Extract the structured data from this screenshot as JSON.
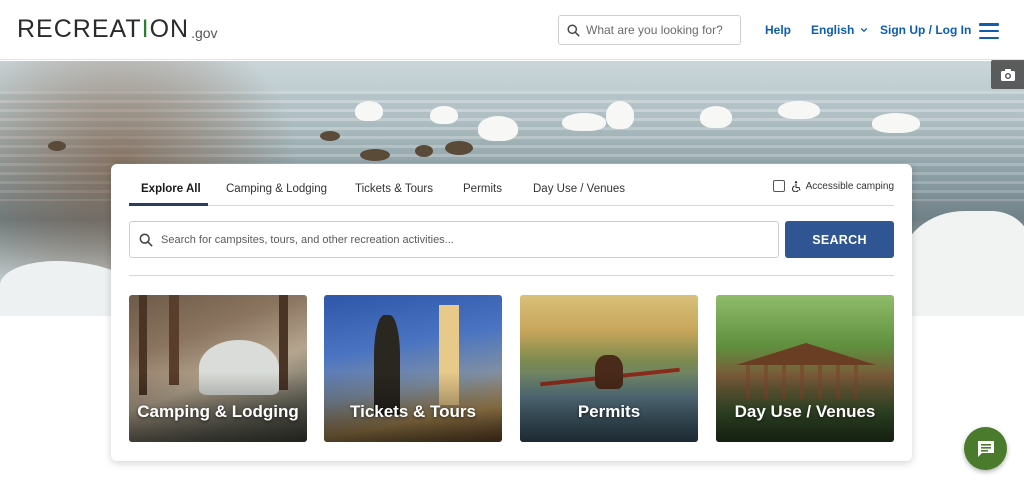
{
  "header": {
    "logo": {
      "main_pre": "RECREAT",
      "main_icon": "I",
      "main_post": "ON",
      "suffix": ".gov"
    },
    "search_placeholder": "What are you looking for?",
    "nav": {
      "help": "Help",
      "language": "English",
      "sign_in": "Sign Up / Log In"
    }
  },
  "hero": {
    "camera_icon": "camera-icon"
  },
  "search_card": {
    "tabs": [
      {
        "label": "Explore All",
        "active": true
      },
      {
        "label": "Camping & Lodging",
        "active": false
      },
      {
        "label": "Tickets & Tours",
        "active": false
      },
      {
        "label": "Permits",
        "active": false
      },
      {
        "label": "Day Use / Venues",
        "active": false
      }
    ],
    "accessible_label": "Accessible camping",
    "accessible_checked": false,
    "search_placeholder": "Search for campsites, tours, and other recreation activities...",
    "search_button": "SEARCH",
    "tiles": [
      {
        "label": "Camping & Lodging"
      },
      {
        "label": "Tickets & Tours"
      },
      {
        "label": "Permits"
      },
      {
        "label": "Day Use / Venues"
      }
    ]
  },
  "colors": {
    "brand_blue": "#2f5593",
    "link_blue": "#0e5eab",
    "chat_green": "#4a7a2c"
  }
}
